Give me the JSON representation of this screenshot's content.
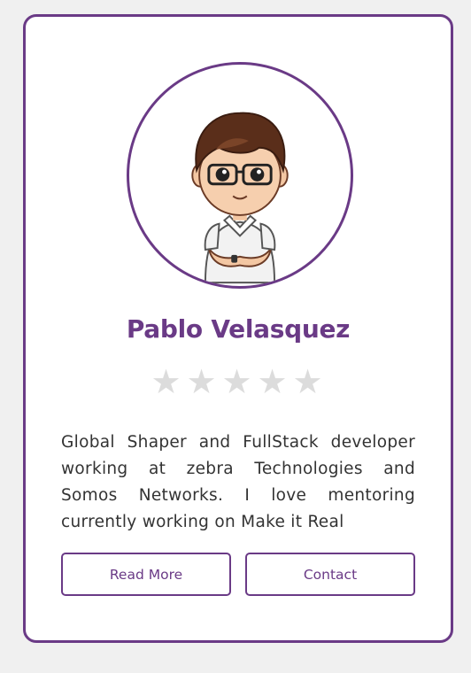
{
  "profile": {
    "name": "Pablo Velasquez",
    "avatar_icon": "cartoon-developer-avatar",
    "rating": {
      "max": 5,
      "value": 0,
      "star_glyph": "★"
    },
    "bio": "Global Shaper and FullStack developer working at zebra Technologies and Somos Networks. I love mentoring currently working on Make it Real"
  },
  "actions": {
    "read_more_label": "Read More",
    "contact_label": "Contact"
  },
  "colors": {
    "accent": "#6a3a86",
    "background": "#f0f0f0",
    "card": "#ffffff",
    "star_empty": "#dcdcdc",
    "text": "#333333"
  }
}
